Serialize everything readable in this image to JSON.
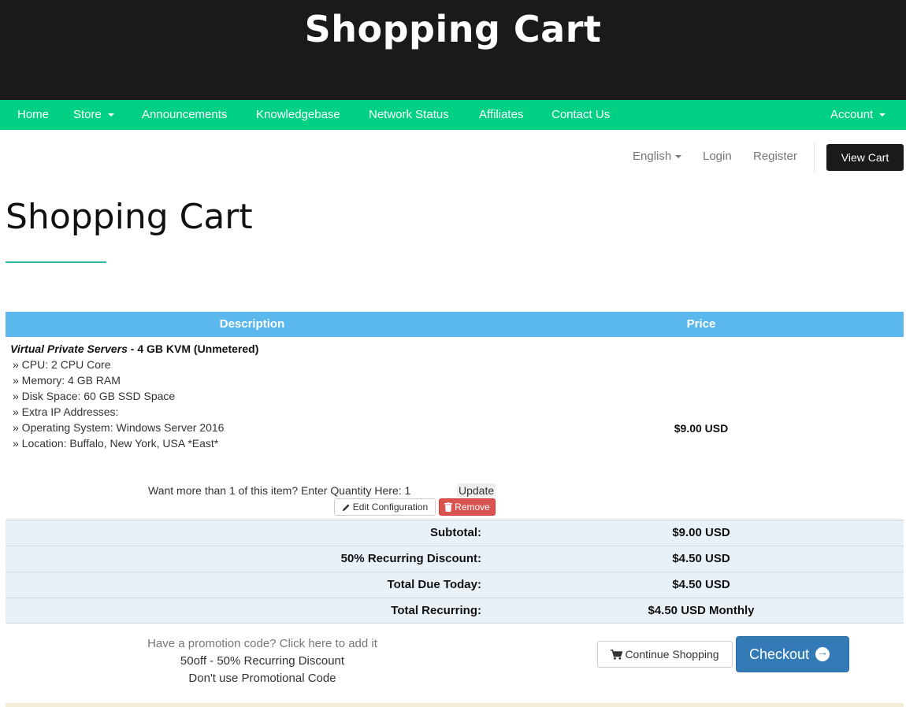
{
  "header": {
    "title": "Shopping Cart"
  },
  "nav": {
    "items": [
      {
        "label": "Home"
      },
      {
        "label": "Store"
      },
      {
        "label": "Announcements"
      },
      {
        "label": "Knowledgebase"
      },
      {
        "label": "Network Status"
      },
      {
        "label": "Affiliates"
      },
      {
        "label": "Contact Us"
      }
    ],
    "account": "Account"
  },
  "utility": {
    "language": "English",
    "login": "Login",
    "register": "Register",
    "view_cart": "View Cart"
  },
  "page": {
    "title": "Shopping Cart"
  },
  "table": {
    "headers": {
      "description": "Description",
      "price": "Price"
    }
  },
  "item": {
    "group": "Virtual Private Servers",
    "name": " - 4 GB KVM (Unmetered)",
    "specs": [
      "» CPU: 2 CPU Core",
      "» Memory: 4 GB RAM",
      "» Disk Space: 60 GB SSD Space",
      "» Extra IP Addresses:",
      "» Operating System: Windows Server 2016",
      "» Location: Buffalo, New York, USA *East*"
    ],
    "price": "$9.00 USD",
    "quantity_text": "Want more than 1 of this item? Enter Quantity Here: 1",
    "update_label": "Update",
    "edit_label": "Edit Configuration",
    "remove_label": "Remove"
  },
  "totals": [
    {
      "label": "Subtotal:",
      "value": "$9.00 USD"
    },
    {
      "label": "50% Recurring Discount:",
      "value": "$4.50 USD"
    },
    {
      "label": "Total Due Today:",
      "value": "$4.50 USD"
    },
    {
      "label": "Total Recurring:",
      "value": "$4.50 USD Monthly"
    }
  ],
  "promo": {
    "add_link": "Have a promotion code? Click here to add it",
    "applied": "50off - 50% Recurring Discount",
    "remove_link": "Don't use Promotional Code"
  },
  "actions": {
    "continue_shopping": "Continue Shopping",
    "checkout": "Checkout"
  },
  "colors": {
    "header_bg": "#1a1a1a",
    "nav_bg": "#00d084",
    "table_header_bg": "#5ab8ec",
    "totals_bg": "#e9f1f8",
    "remove_btn": "#d9534f",
    "checkout_btn": "#337ab7"
  }
}
